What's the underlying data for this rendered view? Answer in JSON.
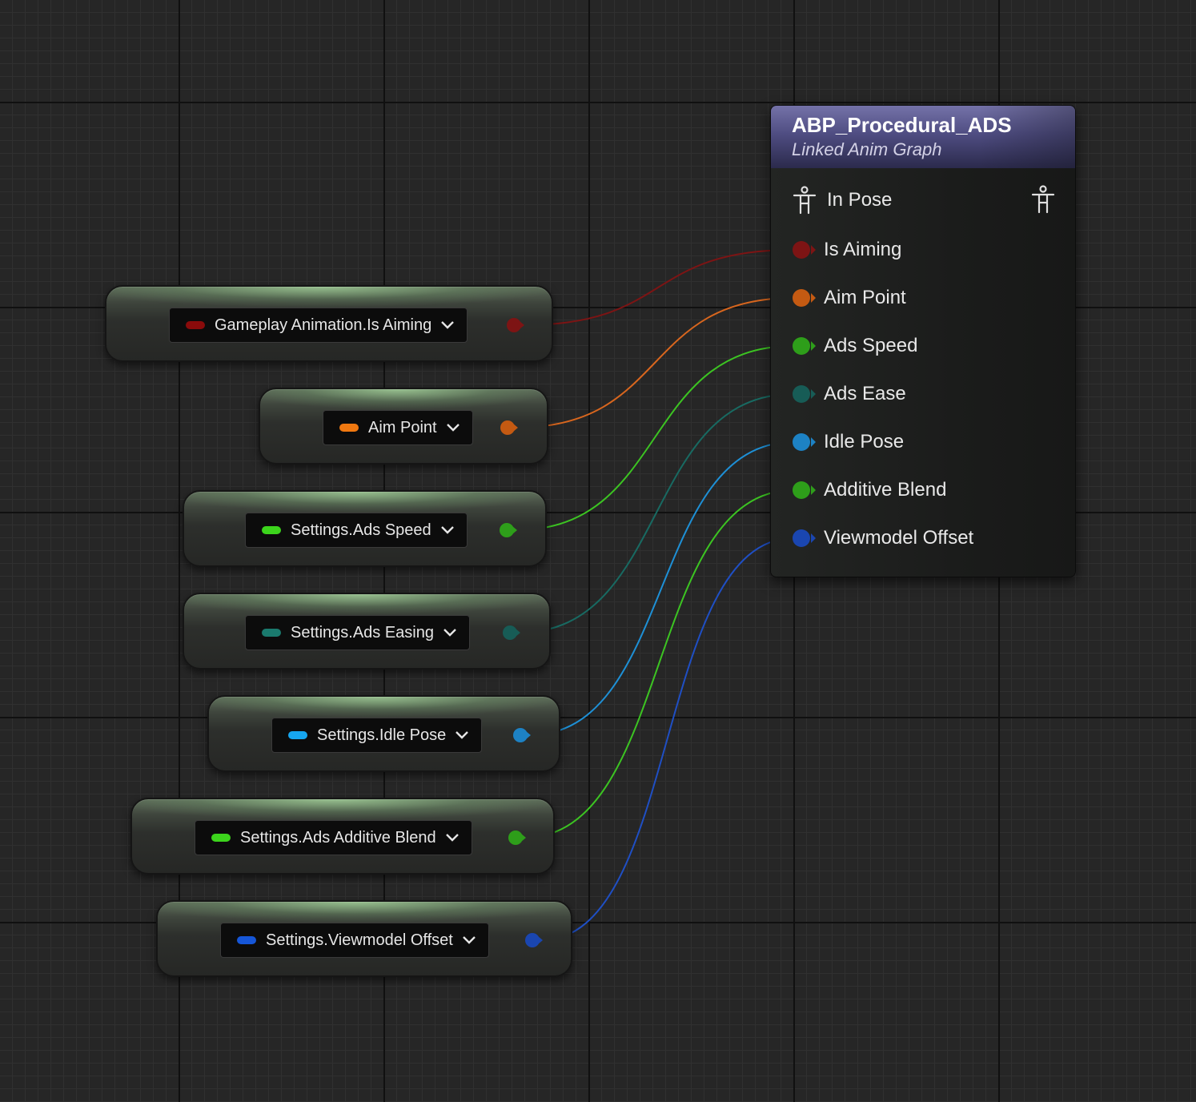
{
  "graph": {
    "variables": [
      {
        "label": "Gameplay Animation.Is Aiming",
        "color": "#8a0b0b",
        "pin_color": "#7d1414"
      },
      {
        "label": "Aim Point",
        "color": "#f07810",
        "pin_color": "#c45a12"
      },
      {
        "label": "Settings.Ads Speed",
        "color": "#3cd41c",
        "pin_color": "#2e9e1a"
      },
      {
        "label": "Settings.Ads Easing",
        "color": "#1a7a6e",
        "pin_color": "#175c56"
      },
      {
        "label": "Settings.Idle Pose",
        "color": "#16a6f0",
        "pin_color": "#1d82c4"
      },
      {
        "label": "Settings.Ads Additive Blend",
        "color": "#3cd41c",
        "pin_color": "#2e9e1a"
      },
      {
        "label": "Settings.Viewmodel Offset",
        "color": "#1656d8",
        "pin_color": "#1a46b0"
      }
    ],
    "linked_node": {
      "title": "ABP_Procedural_ADS",
      "subtitle": "Linked Anim Graph",
      "pose_pin": "In Pose",
      "pins": [
        {
          "label": "Is Aiming",
          "color": "#7d1414"
        },
        {
          "label": "Aim Point",
          "color": "#c45a12"
        },
        {
          "label": "Ads Speed",
          "color": "#2e9e1a"
        },
        {
          "label": "Ads Ease",
          "color": "#175c56"
        },
        {
          "label": "Idle Pose",
          "color": "#1d82c4"
        },
        {
          "label": "Additive Blend",
          "color": "#2e9e1a"
        },
        {
          "label": "Viewmodel Offset",
          "color": "#1a46b0"
        }
      ]
    },
    "wire_colors": [
      "#7d1414",
      "#d8661e",
      "#3cc422",
      "#186a62",
      "#1e90d6",
      "#3cc422",
      "#1f4fc4"
    ]
  }
}
